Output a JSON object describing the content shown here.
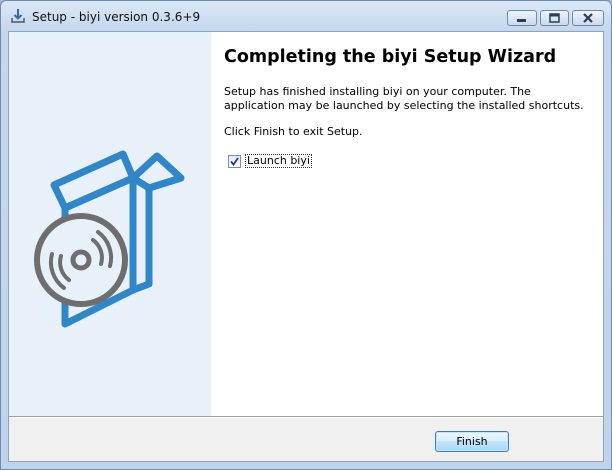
{
  "window": {
    "title": "Setup - biyi version 0.3.6+9",
    "icon": "installer-download-icon"
  },
  "controls": {
    "minimize_icon": "minimize-icon",
    "maximize_icon": "maximize-icon",
    "close_icon": "close-icon"
  },
  "sidebar": {
    "image": "software-box-with-disc-icon",
    "colors": {
      "accent": "#2f86c8",
      "disc": "#6e6e6e",
      "background": "#e8f1fa"
    }
  },
  "page": {
    "heading": "Completing the biyi Setup Wizard",
    "paragraph1": "Setup has finished installing biyi on your computer. The application may be launched by selecting the installed shortcuts.",
    "paragraph2": "Click Finish to exit Setup.",
    "launch_checkbox": {
      "label": "Launch biyi",
      "checked": true
    }
  },
  "footer": {
    "finish_button": "Finish"
  }
}
